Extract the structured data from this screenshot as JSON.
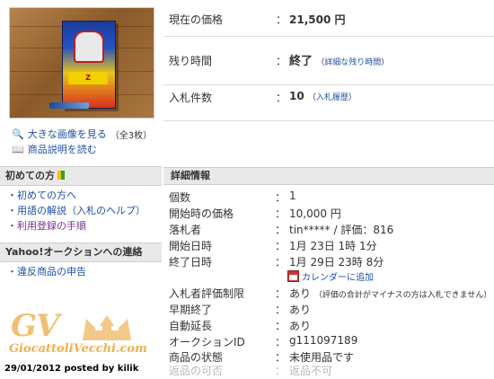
{
  "left": {
    "large_image_link": "大きな画像を見る",
    "large_image_count": "（全3枚）",
    "description_link": "商品説明を読む",
    "beginners": {
      "title": "初めての方",
      "items": [
        "初めての方へ",
        "用語の解説（入札のヘルプ）",
        "利用登録の手順"
      ]
    },
    "contact": {
      "title": "Yahoo!オークションへの連絡",
      "items": [
        "違反商品の申告"
      ]
    }
  },
  "watermark": {
    "logo": "GV",
    "site": "GiocattoliVecchi.com",
    "posted": "29/01/2012 posted by kilik"
  },
  "summary": {
    "price_label": "現在の価格",
    "price_value": "21,500 円",
    "time_label": "残り時間",
    "time_value": "終了",
    "time_link": "詳細な残り時間",
    "bids_label": "入札件数",
    "bids_value": "10",
    "bids_link": "入札履歴"
  },
  "details": {
    "title": "詳細情報",
    "rows": [
      {
        "label": "個数",
        "value": "1"
      },
      {
        "label": "開始時の価格",
        "value": "10,000 円"
      },
      {
        "label": "落札者",
        "value": "tin***** / 評価：816"
      },
      {
        "label": "開始日時",
        "value": "1月 23日 1時 1分"
      },
      {
        "label": "終了日時",
        "value": "1月 29日 23時 8分"
      },
      {
        "label": "入札者評価制限",
        "value": "あり",
        "note": "（評価の合計がマイナスの方は入札できません）"
      },
      {
        "label": "早期終了",
        "value": "あり"
      },
      {
        "label": "自動延長",
        "value": "あり"
      },
      {
        "label": "オークションID",
        "value": "g111097189"
      },
      {
        "label": "商品の状態",
        "value": "未使用品です"
      },
      {
        "label": "返品の可否",
        "value": "返品不可"
      }
    ],
    "calendar_link": "カレンダーに追加"
  },
  "colon": "："
}
